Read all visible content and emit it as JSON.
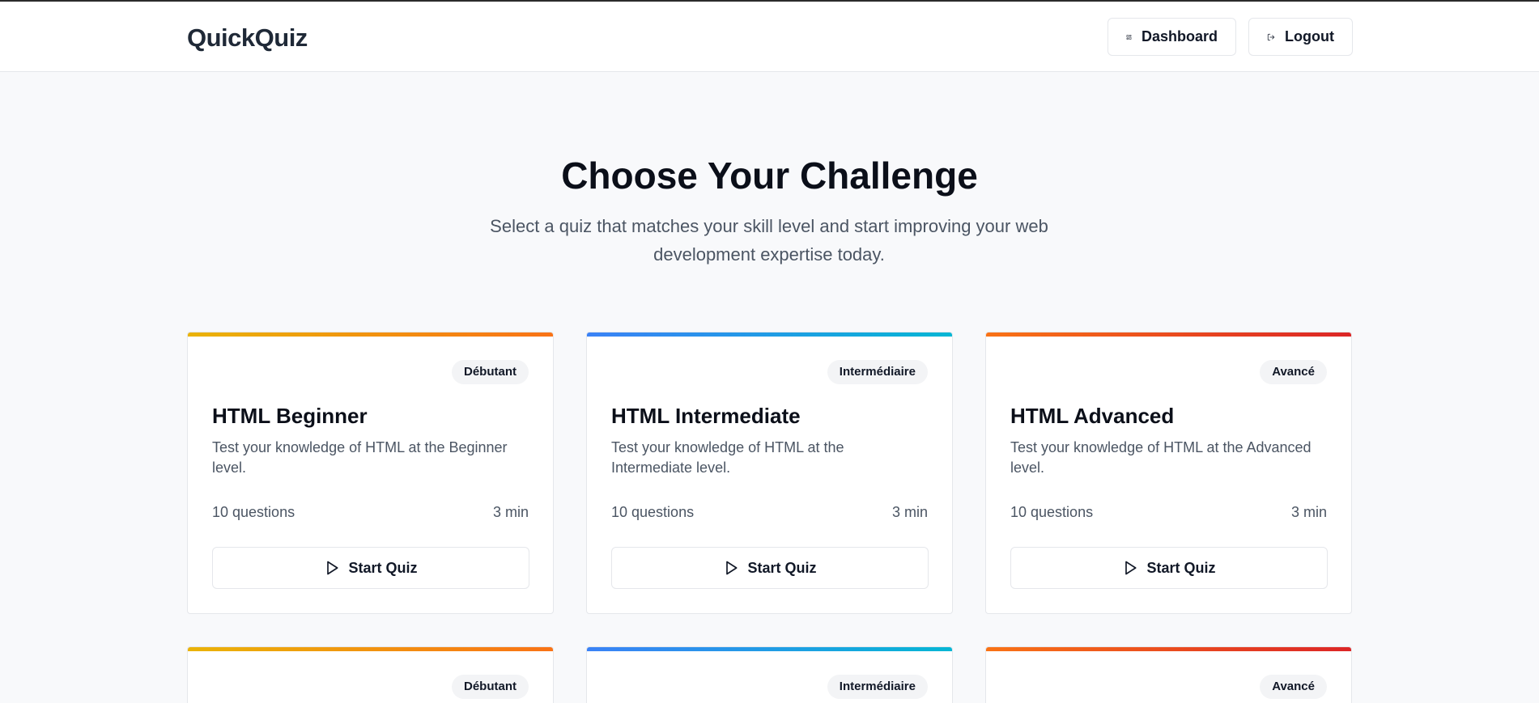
{
  "app": {
    "logo": "QuickQuiz"
  },
  "nav": {
    "dashboard_label": "Dashboard",
    "logout_label": "Logout"
  },
  "hero": {
    "title": "Choose Your Challenge",
    "subtitle": "Select a quiz that matches your skill level and start improving your web development expertise today."
  },
  "icons": {
    "dashboard": "layout-dashboard-icon",
    "logout": "log-out-icon",
    "start": "play-icon"
  },
  "colors": {
    "beginner_gradient": [
      "#eab308",
      "#f97316"
    ],
    "intermediate_gradient": [
      "#3b82f6",
      "#06b6d4"
    ],
    "advanced_gradient": [
      "#f97316",
      "#dc2626"
    ]
  },
  "quizzes": [
    {
      "badge": "Débutant",
      "title": "HTML Beginner",
      "description": "Test your knowledge of HTML at the Beginner level.",
      "questions": "10 questions",
      "duration": "3 min",
      "button": "Start Quiz"
    },
    {
      "badge": "Intermédiaire",
      "title": "HTML Intermediate",
      "description": "Test your knowledge of HTML at the Intermediate level.",
      "questions": "10 questions",
      "duration": "3 min",
      "button": "Start Quiz"
    },
    {
      "badge": "Avancé",
      "title": "HTML Advanced",
      "description": "Test your knowledge of HTML at the Advanced level.",
      "questions": "10 questions",
      "duration": "3 min",
      "button": "Start Quiz"
    },
    {
      "badge": "Débutant"
    },
    {
      "badge": "Intermédiaire"
    },
    {
      "badge": "Avancé"
    }
  ]
}
